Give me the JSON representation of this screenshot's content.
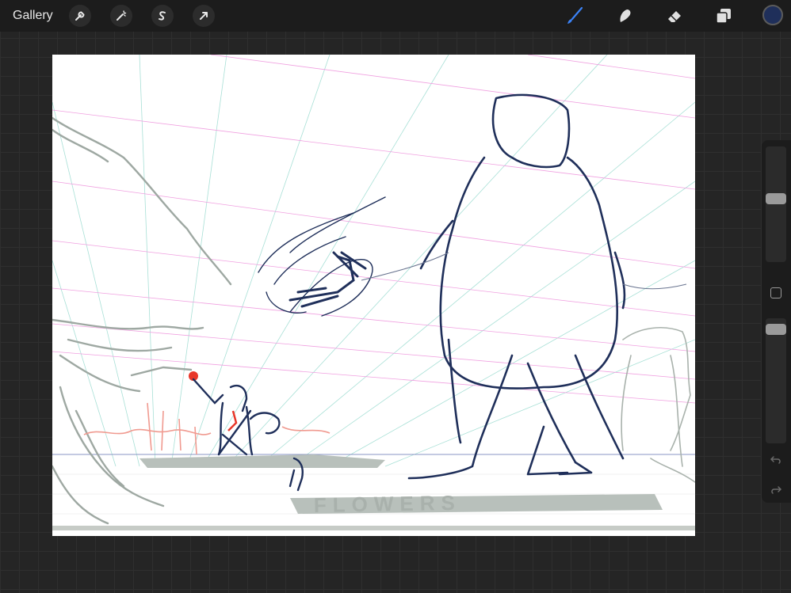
{
  "topbar": {
    "gallery_label": "Gallery",
    "left_tools": [
      {
        "name": "actions",
        "icon": "wrench-icon"
      },
      {
        "name": "adjustments",
        "icon": "magic-wand-icon"
      },
      {
        "name": "selection",
        "icon": "selection-s-icon"
      },
      {
        "name": "transform",
        "icon": "arrow-cursor-icon"
      }
    ],
    "right_tools": [
      {
        "name": "brush",
        "icon": "brush-icon",
        "active": true
      },
      {
        "name": "smudge",
        "icon": "smudge-icon"
      },
      {
        "name": "eraser",
        "icon": "eraser-icon"
      },
      {
        "name": "layers",
        "icon": "layers-icon"
      }
    ],
    "current_color": "#1f2f5a",
    "accent_color": "#3b82f6"
  },
  "sidebar": {
    "brush_size_level": 0.55,
    "opacity_level": 0.95,
    "undo_icon": "undo-icon",
    "redo_icon": "redo-icon"
  },
  "canvas": {
    "background": "#ffffff",
    "lettering": "FLOWERS"
  }
}
